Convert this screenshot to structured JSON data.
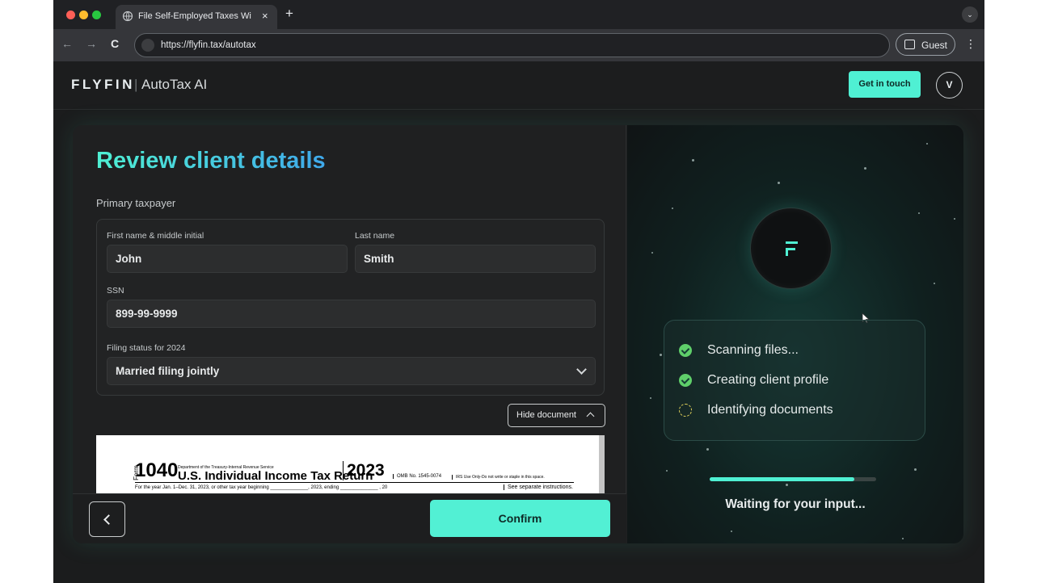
{
  "browser": {
    "tab_title": "File Self-Employed Taxes Wit",
    "tab_close": "×",
    "new_tab": "+",
    "url": "https://flyfin.tax/autotax",
    "profile_label": "Guest",
    "back_glyph": "←",
    "forward_glyph": "→",
    "reload_glyph": "C",
    "menu_glyph": "⋮",
    "tab_menu_glyph": "⌄",
    "traffic_colors": [
      "#ff5f57",
      "#febc2e",
      "#28c840"
    ]
  },
  "header": {
    "logo": "FLYFIN",
    "logo_separator": "|",
    "product": "AutoTax AI",
    "cta_label": "Get in touch",
    "avatar_initial": "V"
  },
  "form": {
    "title": "Review client details",
    "section_label": "Primary taxpayer",
    "first_name": {
      "label": "First name & middle initial",
      "value": "John"
    },
    "last_name": {
      "label": "Last name",
      "value": "Smith"
    },
    "ssn": {
      "label": "SSN",
      "value": "899-99-9999"
    },
    "filing_status": {
      "label": "Filing status for 2024",
      "value": "Married filing jointly"
    },
    "hide_document_label": "Hide document"
  },
  "document_preview": {
    "form_tag": "Form",
    "form_number": "1040",
    "department": "Department of the Treasury-Internal Revenue Service",
    "form_name": "U.S. Individual Income Tax Return",
    "year": "2023",
    "omb": "OMB No. 1545-0074",
    "irs_use": "IRS Use Only-Do not write or staple in this space.",
    "period": "For the year Jan. 1–Dec. 31, 2023, or other tax year beginning ______________, 2023, ending ______________ , 20",
    "instructions": "See separate instructions."
  },
  "footer": {
    "back_glyph": "<",
    "confirm_label": "Confirm"
  },
  "assistant": {
    "steps": [
      {
        "label": "Scanning files...",
        "status": "done"
      },
      {
        "label": "Creating client profile",
        "status": "done"
      },
      {
        "label": "Identifying documents",
        "status": "pending"
      }
    ],
    "progress": 0.87,
    "status_text": "Waiting for your input..."
  },
  "colors": {
    "accent": "#4ff0d3",
    "title_gradient_end": "#3fa8ea",
    "check": "#5fcf6a",
    "pending": "#e0d15a"
  }
}
